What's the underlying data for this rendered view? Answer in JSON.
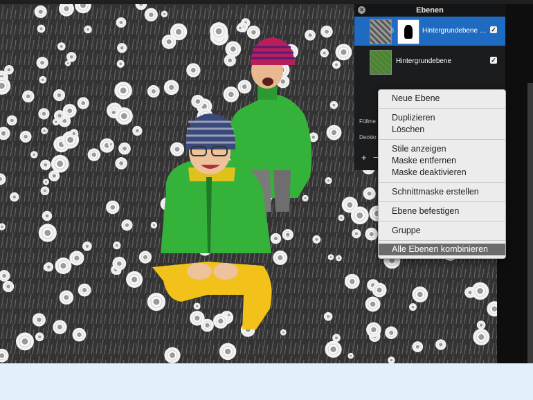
{
  "layers_panel": {
    "title": "Ebenen",
    "layers": [
      {
        "name": "Hintergrundebene …",
        "visible_check": "✓",
        "selected": true
      },
      {
        "name": "Hintergrundebene",
        "visible_check": "✓",
        "selected": false
      }
    ],
    "fill_label": "Füllme",
    "opacity_label": "Deckkr",
    "add_button": "+",
    "remove_button": "−"
  },
  "context_menu": {
    "items": [
      "Neue Ebene",
      "Duplizieren",
      "Löschen",
      "Stile anzeigen",
      "Maske entfernen",
      "Maske deaktivieren",
      "Schnittmaske erstellen",
      "Ebene befestigen",
      "Gruppe",
      "Alle Ebenen kombinieren"
    ],
    "highlighted_item": "Alle Ebenen kombinieren"
  },
  "colors": {
    "selection_blue": "#1f6bc1",
    "menu_background": "#ececec",
    "menu_highlight": "#6b6b6b",
    "panel_background": "#1b1c1e",
    "jacket_green": "#35b23a",
    "pants_yellow": "#f2c21a"
  },
  "icons": {
    "close": "close-icon",
    "chain": "link-icon",
    "visibility": "checkbox-icon"
  }
}
